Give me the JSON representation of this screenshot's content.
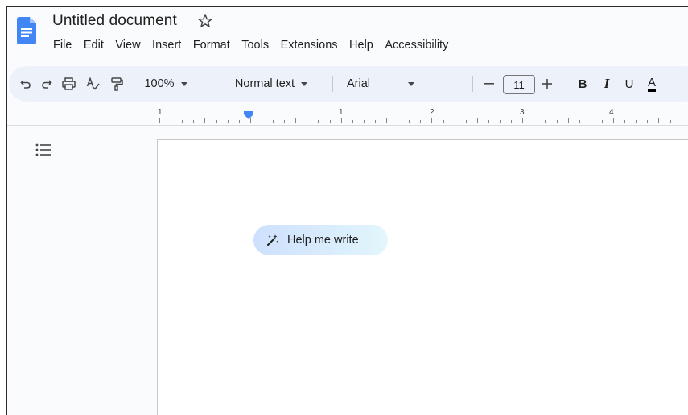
{
  "header": {
    "doc_title": "Untitled document"
  },
  "menubar": {
    "items": [
      "File",
      "Edit",
      "View",
      "Insert",
      "Format",
      "Tools",
      "Extensions",
      "Help",
      "Accessibility"
    ]
  },
  "toolbar": {
    "zoom": "100%",
    "style": "Normal text",
    "font": "Arial",
    "font_size": "11",
    "bold": "B",
    "italic": "I",
    "underline": "U",
    "text_color": "A"
  },
  "ruler": {
    "labels": [
      "1",
      "1",
      "2",
      "3",
      "4"
    ]
  },
  "document": {
    "help_button": "Help me write"
  },
  "colors": {
    "accent": "#1a73e8",
    "toolbar_bg": "#edf2fa",
    "app_bg": "#f9fbfd"
  }
}
